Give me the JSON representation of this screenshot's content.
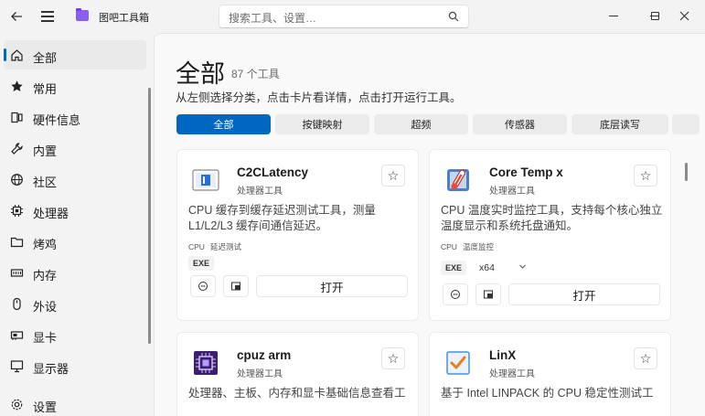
{
  "window": {
    "title": "图吧工具箱",
    "search_placeholder": "搜索工具、设置…",
    "icons": {
      "back": "back-arrow-icon",
      "menu": "hamburger-icon",
      "search": "search-icon",
      "minimize": "minimize-icon",
      "maximize": "maximize-icon",
      "close": "close-icon"
    }
  },
  "sidebar": {
    "items": [
      {
        "label": "全部",
        "icon": "home-icon",
        "active": true
      },
      {
        "label": "常用",
        "icon": "star-icon"
      },
      {
        "label": "硬件信息",
        "icon": "hardware-info-icon"
      },
      {
        "label": "内置",
        "icon": "wrench-icon"
      },
      {
        "label": "社区",
        "icon": "globe-icon"
      },
      {
        "label": "处理器",
        "icon": "cpu-icon"
      },
      {
        "label": "烤鸡",
        "icon": "folder-icon"
      },
      {
        "label": "内存",
        "icon": "memory-icon"
      },
      {
        "label": "外设",
        "icon": "mouse-icon"
      },
      {
        "label": "显卡",
        "icon": "gpu-icon"
      },
      {
        "label": "显示器",
        "icon": "monitor-icon"
      }
    ],
    "settings_label": "设置"
  },
  "main": {
    "title": "全部",
    "count": "87 个工具",
    "subtitle": "从左侧选择分类，点击卡片看详情，点击打开运行工具。",
    "tabs": [
      "全部",
      "按键映射",
      "超频",
      "传感器",
      "底层读写"
    ],
    "active_tab": 0
  },
  "cards": [
    {
      "name": "C2CLatency",
      "category": "处理器工具",
      "description": "CPU 缓存到缓存延迟测试工具，测量 L1/L2/L3 缓存间通信延迟。",
      "tags": [
        "CPU",
        "延迟测试"
      ],
      "badge": "EXE",
      "open_label": "打开",
      "icon": "c2clatency-app-icon"
    },
    {
      "name": "Core Temp x",
      "category": "处理器工具",
      "description": "CPU 温度实时监控工具，支持每个核心独立温度显示和系统托盘通知。",
      "tags": [
        "CPU",
        "温度监控"
      ],
      "badge": "EXE",
      "arch": "x64",
      "open_label": "打开",
      "icon": "coretemp-thermometer-icon"
    },
    {
      "name": "cpuz arm",
      "category": "处理器工具",
      "description": "处理器、主板、内存和显卡基础信息查看工",
      "icon": "cpuz-chip-icon"
    },
    {
      "name": "LinX",
      "category": "处理器工具",
      "description": "基于 Intel LINPACK 的 CPU 稳定性测试工",
      "icon": "linx-checkmark-icon"
    }
  ],
  "colors": {
    "accent": "#0067c0",
    "window_bg": "#f3f3f3",
    "card_bg": "#ffffff"
  }
}
